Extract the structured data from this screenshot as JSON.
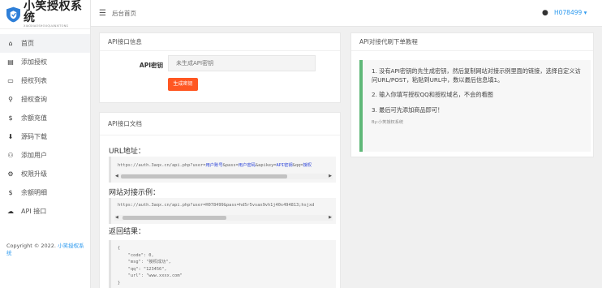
{
  "logo": {
    "title": "小笑授权系统",
    "subtitle": "XIAOXIAOSHOUQUANXITONG"
  },
  "sidebar": {
    "items": [
      {
        "icon": "home-icon",
        "glyph": "⌂",
        "label": "首页"
      },
      {
        "icon": "book-icon",
        "glyph": "▤",
        "label": "添加授权"
      },
      {
        "icon": "monitor-icon",
        "glyph": "▭",
        "label": "授权列表"
      },
      {
        "icon": "search-icon",
        "glyph": "⚲",
        "label": "授权查询"
      },
      {
        "icon": "dollar-icon",
        "glyph": "$",
        "label": "余额充值"
      },
      {
        "icon": "download-icon",
        "glyph": "⬇",
        "label": "源码下载"
      },
      {
        "icon": "user-add-icon",
        "glyph": "⚇",
        "label": "添加用户"
      },
      {
        "icon": "settings-icon",
        "glyph": "⚙",
        "label": "权限升级"
      },
      {
        "icon": "dollar-icon",
        "glyph": "$",
        "label": "余额明细"
      },
      {
        "icon": "cloud-icon",
        "glyph": "☁",
        "label": "API 接口"
      }
    ],
    "copyright_prefix": "Copyright © 2022. ",
    "copyright_link": "小笑授权系统"
  },
  "topbar": {
    "menu_icon": "menu-icon",
    "breadcrumb": "后台首页",
    "theme_icon": "palette-icon",
    "username": "H078499",
    "caret": "▾"
  },
  "api_info": {
    "header": "API接口信息",
    "key_label": "API密钥",
    "key_placeholder": "未生成API密钥",
    "generate_button": "生成密钥"
  },
  "api_docs": {
    "header": "API接口文档",
    "url_title": "URL地址：",
    "url_prefix": "https://auth.3aqx.cn/api.php?user=",
    "url_p1": "用户账号",
    "url_mid1": "&pass=",
    "url_p2": "用户密码",
    "url_mid2": "&apikey=",
    "url_p3": "API密钥",
    "url_mid3": "&qq=",
    "url_p4": "授权",
    "example_title": "网站对接示例：",
    "example_url": "https://auth.3aqx.cn/api.php?user=H078499&pass=hd5r5vsax9vh1j40s494813;hsjxd",
    "result_title": "返回结果：",
    "result_json": "{\n    \"code\": 0,\n    \"msg\": \"授权成功\",\n    \"qq\": \"123456\",\n    \"url\": \"www.xxxx.com\"\n}"
  },
  "tutorial": {
    "header": "API对接代刷下单教程",
    "paragraphs": [
      "1. 没有API密钥的先生成密钥，然后复制网站对接示例里面的链接，选择自定义访问URL/POST，粘贴到URL中，数以最后信息填1。",
      "2. 输入你填写授权QQ和授权域名，不会的看图",
      "3. 最后可先添加商品即可！"
    ],
    "note": "By:小笑授权系统"
  },
  "colors": {
    "accent_blue": "#2e9aef",
    "danger_orange": "#ff5722",
    "tutorial_green": "#5fb878"
  }
}
